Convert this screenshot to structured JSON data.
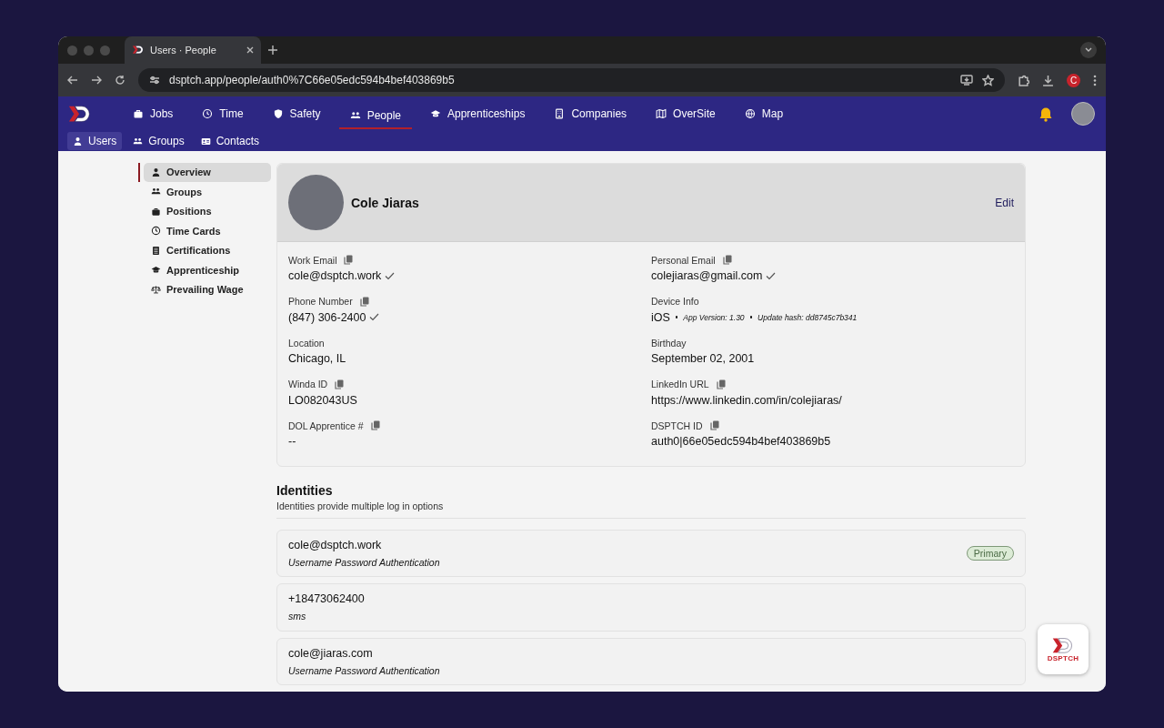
{
  "browser": {
    "tab_title": "Users · People",
    "url": "dsptch.app/people/auth0%7C66e05edc594b4bef403869b5",
    "profile_letter": "C"
  },
  "nav": [
    {
      "label": "Jobs",
      "selected": false
    },
    {
      "label": "Time",
      "selected": false
    },
    {
      "label": "Safety",
      "selected": false
    },
    {
      "label": "People",
      "selected": true
    },
    {
      "label": "Apprenticeships",
      "selected": false
    },
    {
      "label": "Companies",
      "selected": false
    },
    {
      "label": "OverSite",
      "selected": false
    },
    {
      "label": "Map",
      "selected": false
    }
  ],
  "subnav": [
    {
      "label": "Users",
      "selected": true
    },
    {
      "label": "Groups",
      "selected": false
    },
    {
      "label": "Contacts",
      "selected": false
    }
  ],
  "sidebar": [
    {
      "label": "Overview",
      "selected": true
    },
    {
      "label": "Groups",
      "selected": false
    },
    {
      "label": "Positions",
      "selected": false
    },
    {
      "label": "Time Cards",
      "selected": false
    },
    {
      "label": "Certifications",
      "selected": false
    },
    {
      "label": "Apprenticeship",
      "selected": false
    },
    {
      "label": "Prevailing Wage",
      "selected": false
    }
  ],
  "profile": {
    "name": "Cole Jiaras",
    "edit": "Edit"
  },
  "details": {
    "left": [
      {
        "kind": "text",
        "label": "Work Email",
        "value": "cole@dsptch.work",
        "copyable": true,
        "verified": true
      },
      {
        "kind": "text",
        "label": "Phone Number",
        "value": "(847) 306-2400",
        "copyable": true,
        "verified": true
      },
      {
        "kind": "text",
        "label": "Location",
        "value": "Chicago, IL",
        "copyable": false,
        "verified": false
      },
      {
        "kind": "text",
        "label": "Winda ID",
        "value": "LO082043US",
        "copyable": true,
        "verified": false
      },
      {
        "kind": "text",
        "label": "DOL Apprentice #",
        "value": "--",
        "copyable": true,
        "verified": false
      }
    ],
    "right": [
      {
        "kind": "text",
        "label": "Personal Email",
        "value": "colejiaras@gmail.com",
        "copyable": true,
        "verified": true
      },
      {
        "kind": "device",
        "label": "Device Info",
        "os": "iOS",
        "app_version": "App Version: 1.30",
        "update_hash": "Update hash: dd8745c7b341",
        "copyable": false,
        "verified": false
      },
      {
        "kind": "text",
        "label": "Birthday",
        "value": "September 02, 2001",
        "copyable": false,
        "verified": false
      },
      {
        "kind": "text",
        "label": "LinkedIn URL",
        "value": "https://www.linkedin.com/in/colejiaras/",
        "copyable": true,
        "verified": false
      },
      {
        "kind": "text",
        "label": "DSPTCH ID",
        "value": "auth0|66e05edc594b4bef403869b5",
        "copyable": true,
        "verified": false
      }
    ]
  },
  "identities": {
    "title": "Identities",
    "subtitle": "Identities provide multiple log in options",
    "items": [
      {
        "value": "cole@dsptch.work",
        "method": "Username Password Authentication",
        "primary": true,
        "badge": "Primary"
      },
      {
        "value": "+18473062400",
        "method": "sms",
        "primary": false
      },
      {
        "value": "cole@jiaras.com",
        "method": "Username Password Authentication",
        "primary": false
      }
    ]
  },
  "floating_logo": {
    "caption": "DSPTCH"
  }
}
